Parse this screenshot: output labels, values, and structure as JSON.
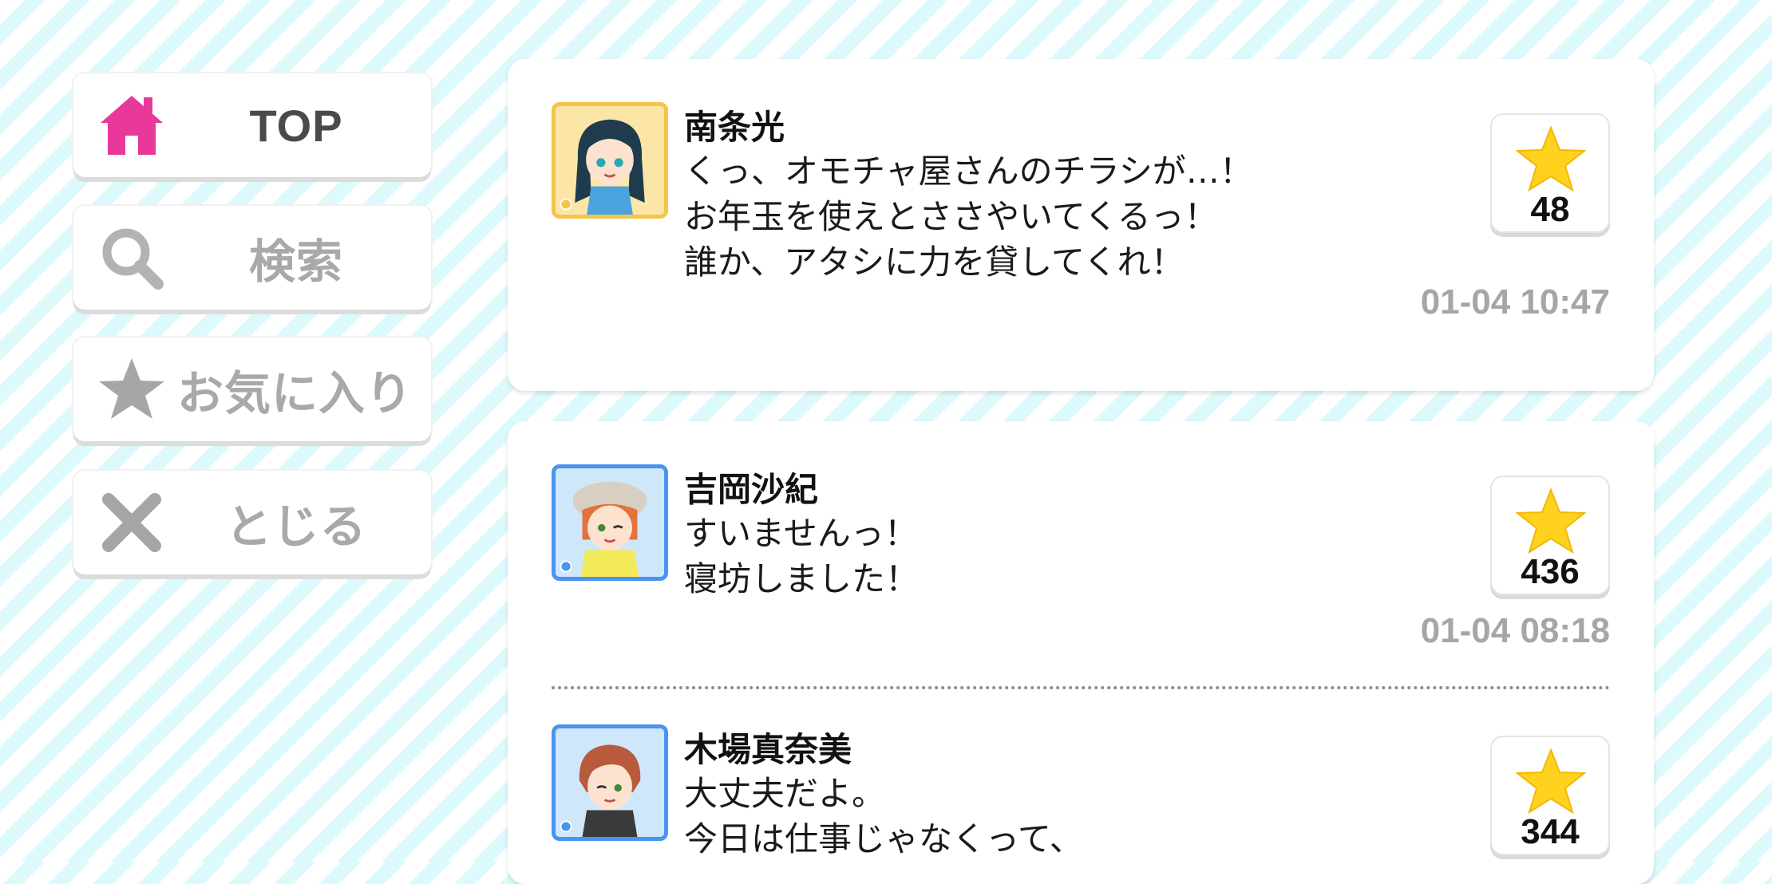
{
  "nav": [
    {
      "label": "TOP",
      "icon": "home-icon",
      "active": true
    },
    {
      "label": "検索",
      "icon": "search-icon",
      "active": false
    },
    {
      "label": "お気に入り",
      "icon": "star-icon",
      "active": false
    },
    {
      "label": "とじる",
      "icon": "close-icon",
      "active": false
    }
  ],
  "posts": [
    {
      "name": "南条光",
      "message": "くっ、オモチャ屋さんのチラシが…！\nお年玉を使えとささやいてくるっ！\n誰か、アタシに力を貸してくれ！",
      "likes": "48",
      "time": "01-04 10:47"
    },
    {
      "name": "吉岡沙紀",
      "message": "すいませんっ！\n寝坊しました！",
      "likes": "436",
      "time": "01-04 08:18"
    },
    {
      "name": "木場真奈美",
      "message": "大丈夫だよ。\n今日は仕事じゃなくって、",
      "likes": "344",
      "time": ""
    }
  ],
  "colors": {
    "accent_pink": "#e8389a",
    "inactive_gray": "#a9a9a9",
    "star_yellow": "#ffd21e",
    "stripe": "#dcf9fb"
  }
}
